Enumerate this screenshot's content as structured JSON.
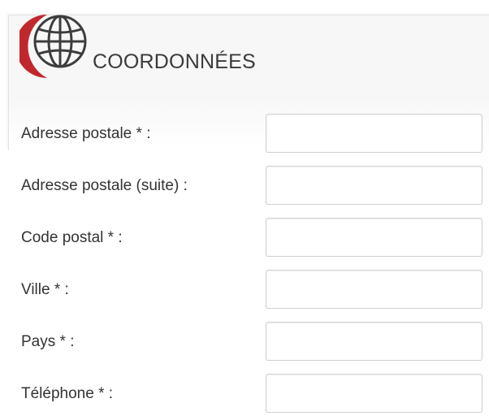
{
  "section": {
    "title": "COORDONNÉES",
    "icon": "globe-icon"
  },
  "fields": [
    {
      "label": "Adresse postale * :",
      "value": "",
      "placeholder": ""
    },
    {
      "label": "Adresse postale (suite) :",
      "value": "",
      "placeholder": ""
    },
    {
      "label": "Code postal * :",
      "value": "",
      "placeholder": ""
    },
    {
      "label": "Ville * :",
      "value": "",
      "placeholder": ""
    },
    {
      "label": "Pays * :",
      "value": "",
      "placeholder": ""
    },
    {
      "label": "Téléphone * :",
      "value": "",
      "placeholder": ""
    }
  ],
  "colors": {
    "accent": "#c0282d",
    "panel": "#f7f7f7",
    "text": "#333333",
    "border": "#cfcfcf"
  }
}
